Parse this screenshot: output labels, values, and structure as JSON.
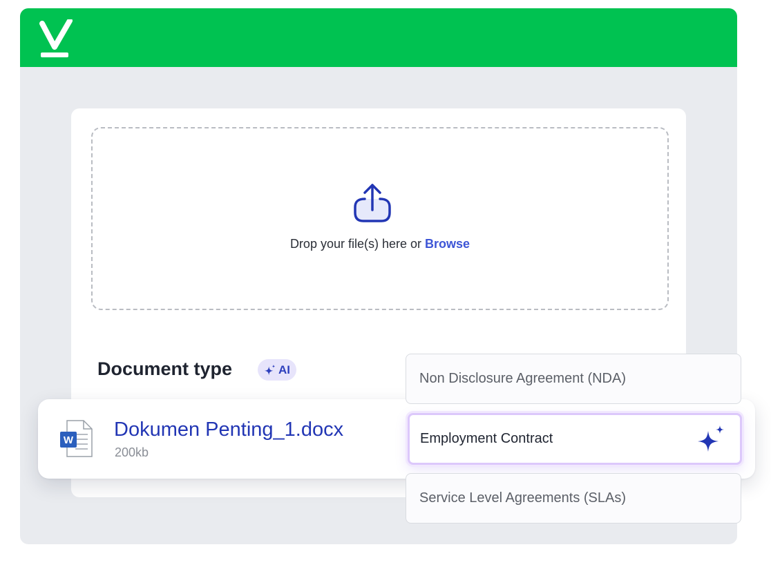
{
  "upload": {
    "drop_text": "Drop your file(s) here or",
    "browse_label": "Browse"
  },
  "document_type": {
    "label": "Document type",
    "ai_badge": "AI"
  },
  "file": {
    "name": "Dokumen Penting_1.docx",
    "size": "200kb",
    "icon_letter": "W"
  },
  "options": [
    {
      "label": "Non Disclosure Agreement (NDA)",
      "selected": false
    },
    {
      "label": "Employment Contract",
      "selected": true
    },
    {
      "label": "Service Level Agreements (SLAs)",
      "selected": false
    }
  ],
  "icons": {
    "logo": "checkmark-logo-icon",
    "upload": "upload-icon",
    "ai": "sparkle-icon",
    "file": "word-document-icon"
  },
  "colors": {
    "header": "#00c251",
    "accent": "#2236b4",
    "browse": "#3d55d6",
    "selection_glow": "#dcc8fb"
  }
}
